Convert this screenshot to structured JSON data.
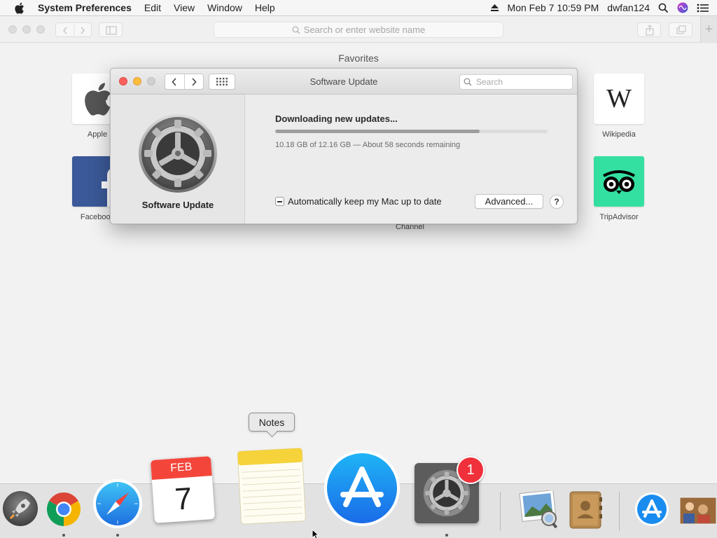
{
  "menubar": {
    "app_name": "System Preferences",
    "menus": [
      "Edit",
      "View",
      "Window",
      "Help"
    ],
    "datetime": "Mon Feb 7  10:59 PM",
    "user": "dwfan124"
  },
  "safari": {
    "address_placeholder": "Search or enter website name",
    "favorites_title": "Favorites",
    "favorites": [
      {
        "label": "Apple",
        "icon": "apple-logo-icon"
      },
      {
        "label": "Facebook",
        "icon": "facebook-logo-icon"
      },
      {
        "label": "Wikipedia",
        "icon": "wikipedia-logo-icon"
      },
      {
        "label": "TripAdvisor",
        "icon": "tripadvisor-logo-icon"
      }
    ],
    "channel_label": "Channel"
  },
  "software_update": {
    "window_title": "Software Update",
    "search_placeholder": "Search",
    "sidebar_title": "Software Update",
    "status_title": "Downloading new updates...",
    "progress_fraction": 0.75,
    "progress_detail": "10.18 GB of 12.16 GB — About 58 seconds remaining",
    "auto_update_label": "Automatically keep my Mac up to date",
    "auto_update_state": "mixed",
    "advanced_button": "Advanced...",
    "help_button": "?"
  },
  "dock": {
    "tooltip": "Notes",
    "calendar_month": "FEB",
    "calendar_day": "7",
    "sysprefs_badge": "1",
    "apps": [
      "Launchpad",
      "Google Chrome",
      "Safari",
      "Calendar",
      "Notes",
      "App Store",
      "System Preferences",
      "Preview",
      "Contacts",
      "App Store Downloads",
      "Photos"
    ]
  },
  "colors": {
    "close": "#fc605c",
    "minimize": "#fdbc40",
    "badge": "#f0303a",
    "facebook": "#3b5998",
    "tripadvisor": "#34e0a1",
    "app_store": "#1a8cf0"
  }
}
